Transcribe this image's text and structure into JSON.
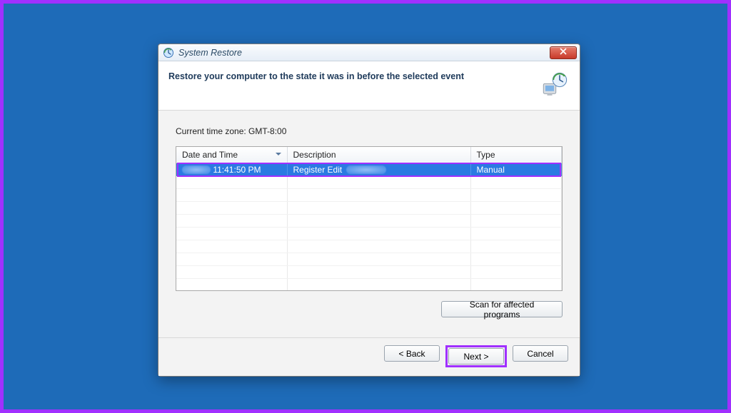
{
  "window": {
    "title": "System Restore"
  },
  "header": {
    "heading": "Restore your computer to the state it was in before the selected event"
  },
  "content": {
    "timezone_label": "Current time zone: GMT-8:00"
  },
  "table": {
    "columns": {
      "date_time": "Date and Time",
      "description": "Description",
      "type": "Type"
    },
    "rows": [
      {
        "time": "11:41:50 PM",
        "description": "Register Edit",
        "type": "Manual"
      }
    ]
  },
  "buttons": {
    "scan": "Scan for affected programs",
    "back": "< Back",
    "next": "Next >",
    "cancel": "Cancel"
  }
}
